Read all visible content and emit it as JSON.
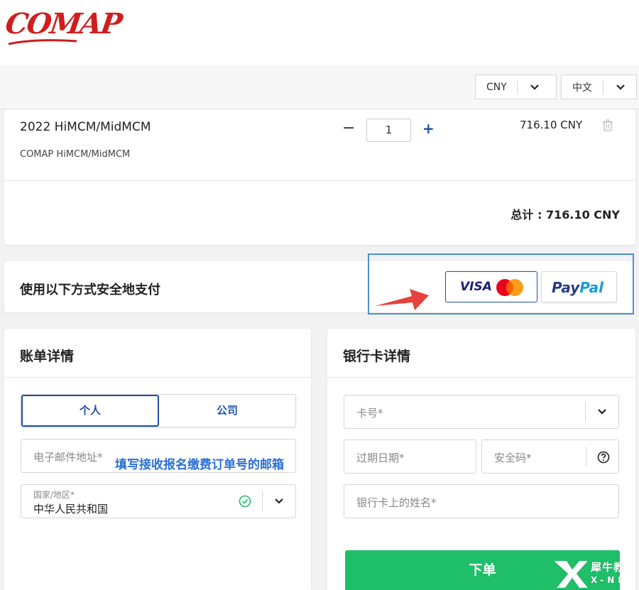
{
  "brand": {
    "logo_text": "COMAP"
  },
  "header": {
    "currency_select": {
      "value": "CNY"
    },
    "language_select": {
      "value": "中文"
    }
  },
  "cart": {
    "item": {
      "title": "2022 HiMCM/MidMCM",
      "subtitle": "COMAP HiMCM/MidMCM",
      "quantity": "1",
      "minus_label": "−",
      "plus_label": "+",
      "price": "716.10 CNY"
    },
    "total": "总计 : 716.10 CNY"
  },
  "payment": {
    "title": "使用以下方式安全地支付",
    "visa_label": "VISA",
    "paypal_label_a": "Pay",
    "paypal_label_b": "Pal",
    "colors": {
      "highlight": "#4a90d9",
      "arrow": "#e8423c"
    }
  },
  "billing": {
    "title": "账单详情",
    "tabs": [
      "个人",
      "公司"
    ],
    "email_placeholder": "电子邮件地址*",
    "country_label": "国家/地区*",
    "country_value": "中华人民共和国",
    "annotation": "填写接收报名缴费订单号的邮箱"
  },
  "card_details": {
    "title": "银行卡详情",
    "card_number_placeholder": "卡号*",
    "expiry_placeholder": "过期日期*",
    "cvc_placeholder": "安全码*",
    "name_placeholder": "银行卡上的姓名*",
    "submit_label": "下单",
    "submit_color": "#1fbf6a"
  },
  "watermark": {
    "text_cn": "犀牛教",
    "text_en": "X-NI"
  }
}
